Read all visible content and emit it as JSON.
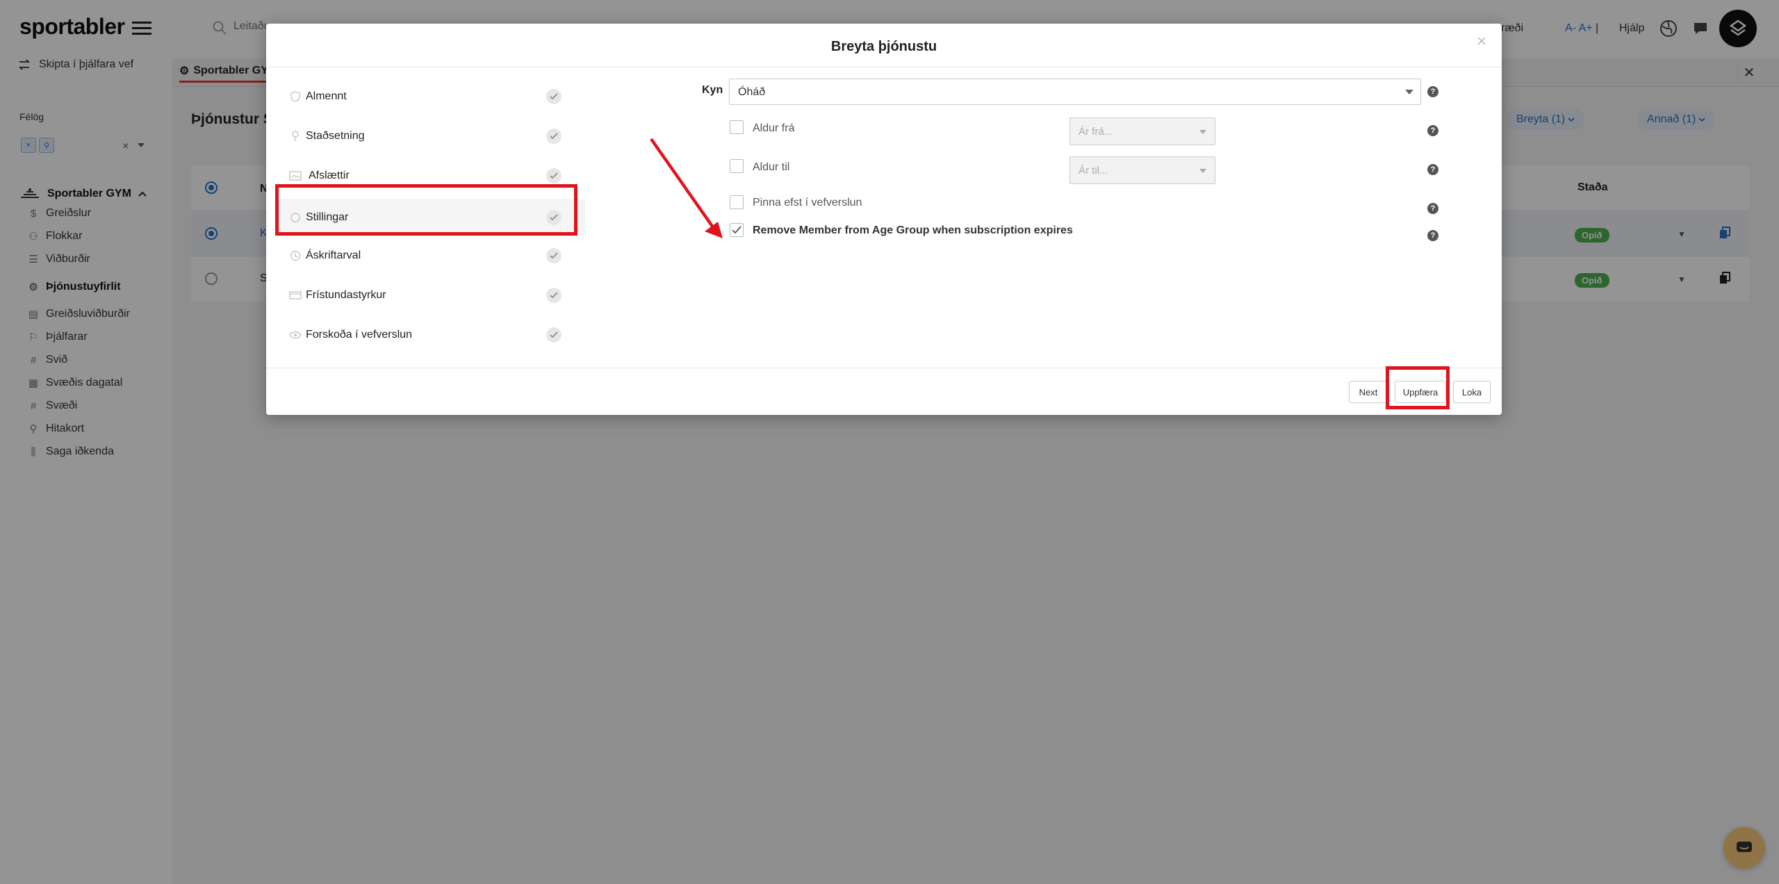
{
  "app": {
    "brand": "sportabler",
    "switch_link": "Skipta í þjálfara vef",
    "felog_label": "Félög",
    "club_name": "Sportabler GYM",
    "nav": [
      {
        "label": "Greiðslur",
        "icon": "dollar-icon"
      },
      {
        "label": "Flokkar",
        "icon": "users-icon"
      },
      {
        "label": "Viðburðir",
        "icon": "list-icon"
      },
      {
        "label": "Þjónustuyfirlit",
        "icon": "gear-icon",
        "active": true
      },
      {
        "label": "Greiðsluviðburðir",
        "icon": "receipt-icon"
      },
      {
        "label": "Þjálfarar",
        "icon": "whistle-icon"
      },
      {
        "label": "Svið",
        "icon": "hash-icon"
      },
      {
        "label": "Svæðis dagatal",
        "icon": "calendar-icon"
      },
      {
        "label": "Svæði",
        "icon": "hash-icon"
      },
      {
        "label": "Hitakort",
        "icon": "pin-icon"
      },
      {
        "label": "Saga iðkenda",
        "icon": "chart-icon"
      }
    ]
  },
  "topbar": {
    "search_placeholder": "Leitaðu",
    "link_partial": "ræði",
    "font_size": "A- A+",
    "separator": "|",
    "help": "Hjálp"
  },
  "background": {
    "tab_label": "Sportabler GYM",
    "page_title": "Þjónustur S",
    "filter_breyta": "Breyta (1)",
    "filter_annad": "Annað (1)",
    "col_first": "N",
    "col_status": "Staða",
    "rows": [
      {
        "first_char": "K",
        "status": "Opið",
        "selected": true
      },
      {
        "first_char": "S",
        "status": "Opið",
        "selected": false
      }
    ]
  },
  "modal": {
    "title": "Breyta þjónustu",
    "steps": [
      {
        "label": "Almennt",
        "icon": "shield-icon"
      },
      {
        "label": "Staðsetning",
        "icon": "pin-icon"
      },
      {
        "label": "Afslættir",
        "icon": "image-icon"
      },
      {
        "label": "Stillingar",
        "icon": "circle-icon",
        "active": true
      },
      {
        "label": "Áskriftarval",
        "icon": "clock-icon"
      },
      {
        "label": "Frístundastyrkur",
        "icon": "card-icon"
      },
      {
        "label": "Forskoða í vefverslun",
        "icon": "eye-icon"
      }
    ],
    "form": {
      "kyn_label": "Kyn",
      "kyn_value": "Óháð",
      "aldur_fra_label": "Aldur frá",
      "aldur_fra_placeholder": "Ár frá...",
      "aldur_til_label": "Aldur til",
      "aldur_til_placeholder": "Ár til...",
      "pinna_label": "Pinna efst í vefverslun",
      "remove_label": "Remove Member from Age Group when subscription expires",
      "remove_checked": true,
      "help_glyph": "?"
    },
    "footer": {
      "next": "Next",
      "update": "Uppfæra",
      "close": "Loka"
    }
  },
  "colors": {
    "accent": "#2a6fc9",
    "highlight": "#e0141e",
    "status_green": "#4caf50"
  }
}
